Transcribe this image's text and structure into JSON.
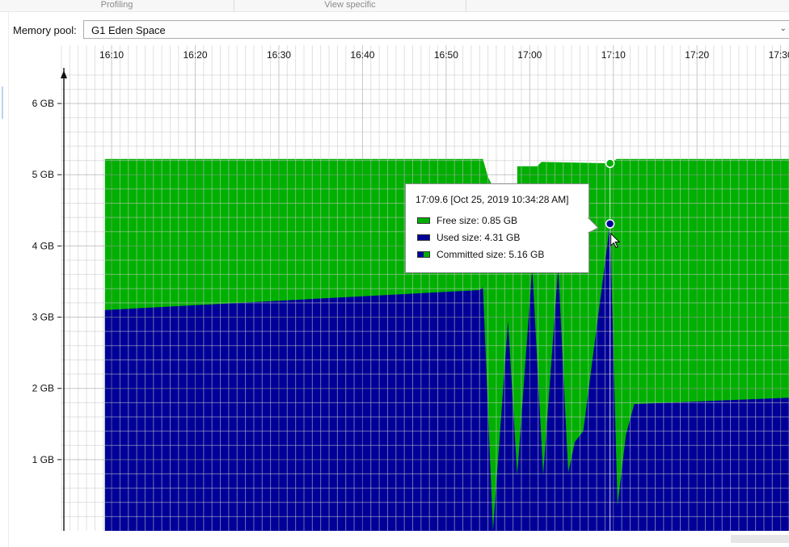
{
  "tabs": {
    "profiling": "Profiling",
    "view_specific": "View specific"
  },
  "memory_pool": {
    "label": "Memory pool:",
    "value": "G1 Eden Space"
  },
  "colors": {
    "free": "#00b000",
    "used": "#000099",
    "grid": "#c8c8c8"
  },
  "chart_data": {
    "type": "area",
    "x_unit": "clock time (HH:MM)",
    "y_unit": "GB",
    "xlim": [
      "16:04",
      "17:31"
    ],
    "ylim": [
      0,
      6.5
    ],
    "x_ticks": [
      "16:10",
      "16:20",
      "16:30",
      "16:40",
      "16:50",
      "17:00",
      "17:10",
      "17:20",
      "17:30"
    ],
    "y_ticks": [
      "1 GB",
      "2 GB",
      "3 GB",
      "4 GB",
      "5 GB",
      "6 GB"
    ],
    "grid": true,
    "series": [
      {
        "name": "Committed size",
        "points": [
          [
            "16:09.2",
            5.22
          ],
          [
            "16:54.4",
            5.22
          ],
          [
            "16:55.0",
            4.97
          ],
          [
            "16:55.6",
            4.83
          ],
          [
            "16:58.5",
            4.83
          ],
          [
            "16:58.5",
            5.12
          ],
          [
            "17:00.9",
            5.12
          ],
          [
            "17:01.4",
            5.18
          ],
          [
            "17:09.6",
            5.16
          ],
          [
            "17:10.4",
            5.22
          ],
          [
            "17:31.0",
            5.22
          ]
        ]
      },
      {
        "name": "Used size",
        "points": [
          [
            "16:09.2",
            3.1
          ],
          [
            "16:54.0",
            3.38
          ],
          [
            "16:54.4",
            3.42
          ],
          [
            "16:55.6",
            0.0
          ],
          [
            "16:57.4",
            2.95
          ],
          [
            "16:58.5",
            0.78
          ],
          [
            "17:00.3",
            3.7
          ],
          [
            "17:01.6",
            0.78
          ],
          [
            "17:03.4",
            3.7
          ],
          [
            "17:04.6",
            0.82
          ],
          [
            "17:05.4",
            1.25
          ],
          [
            "17:06.4",
            1.4
          ],
          [
            "17:09.6",
            4.31
          ],
          [
            "17:10.5",
            0.35
          ],
          [
            "17:11.5",
            1.35
          ],
          [
            "17:12.5",
            1.78
          ],
          [
            "17:31.0",
            1.87
          ]
        ]
      }
    ],
    "tooltip": {
      "time": "17:09.6 [Oct 25, 2019 10:34:28 AM]",
      "free_label": "Free size:  0.85 GB",
      "used_label": "Used size:  4.31 GB",
      "committed_label": "Committed size:  5.16 GB"
    }
  }
}
